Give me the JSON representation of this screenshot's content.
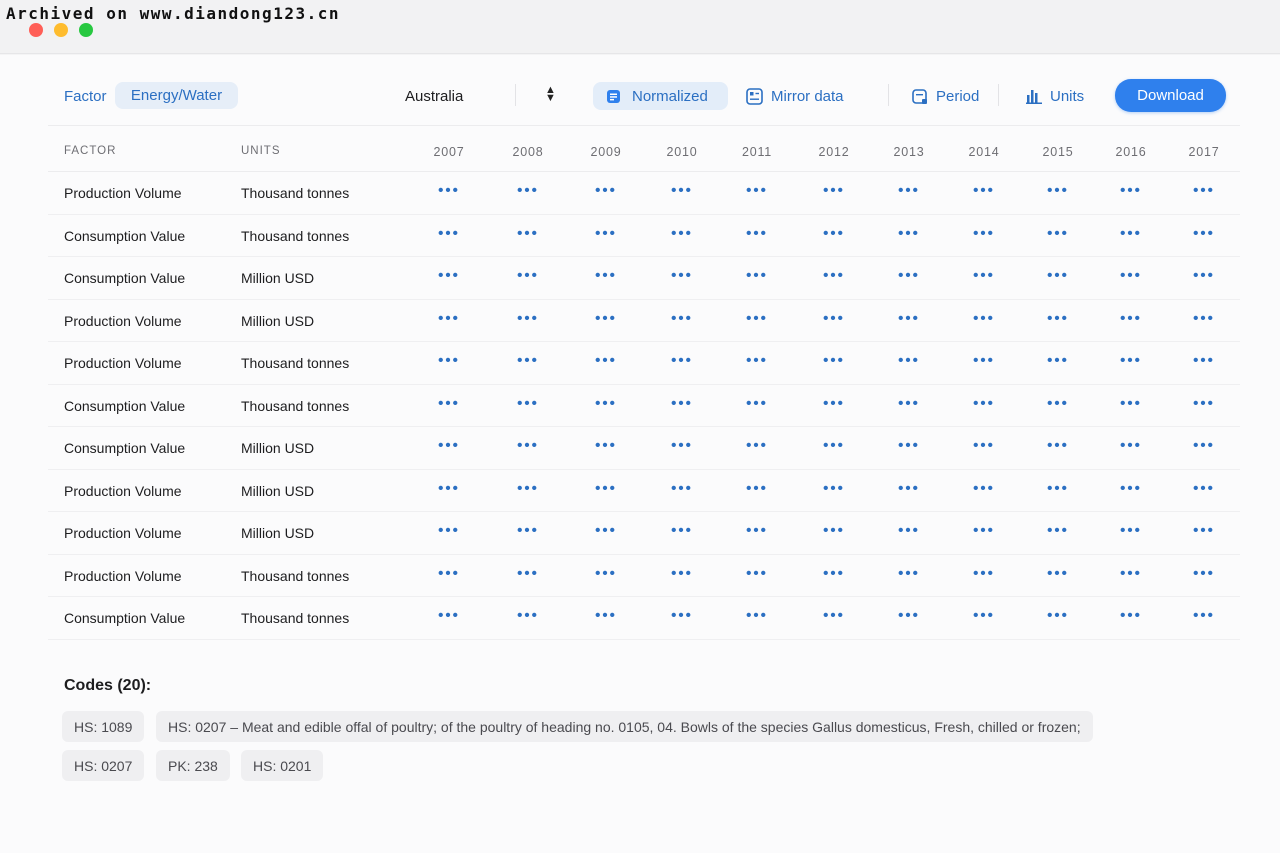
{
  "watermark": "Archived on www.diandong123.cn",
  "toolbar": {
    "factor_label": "Factor",
    "factor_chip": "Energy/Water",
    "country": "Australia",
    "normalized": "Normalized",
    "mirror": "Mirror data",
    "period": "Period",
    "units": "Units",
    "download": "Download"
  },
  "table": {
    "headers": {
      "factor": "FACTOR",
      "units": "UNITS"
    },
    "years": [
      "2007",
      "2008",
      "2009",
      "2010",
      "2011",
      "2012",
      "2013",
      "2014",
      "2015",
      "2016",
      "2017"
    ],
    "cell_placeholder": "•••",
    "rows": [
      {
        "factor": "Production Volume",
        "units": "Thousand tonnes"
      },
      {
        "factor": "Consumption Value",
        "units": "Thousand tonnes"
      },
      {
        "factor": "Consumption Value",
        "units": "Million USD"
      },
      {
        "factor": "Production Volume",
        "units": "Million USD"
      },
      {
        "factor": "Production Volume",
        "units": "Thousand tonnes"
      },
      {
        "factor": "Consumption Value",
        "units": "Thousand tonnes"
      },
      {
        "factor": "Consumption Value",
        "units": "Million USD"
      },
      {
        "factor": "Production Volume",
        "units": "Million USD"
      },
      {
        "factor": "Production Volume",
        "units": "Million USD"
      },
      {
        "factor": "Production Volume",
        "units": "Thousand tonnes"
      },
      {
        "factor": "Consumption Value",
        "units": "Thousand tonnes"
      }
    ]
  },
  "codes": {
    "title": "Codes (20):",
    "items": [
      "HS: 1089",
      "HS: 0207 – Meat and edible offal of poultry; of the poultry of heading no. 0105, 04.  Bowls of the species Gallus domesticus, Fresh, chilled or frozen;",
      "HS: 0207",
      "PK: 238",
      "HS: 0201"
    ]
  },
  "colors": {
    "accent": "#2f80ed",
    "link": "#2b6fc2",
    "chip_bg": "#e3edf9"
  }
}
